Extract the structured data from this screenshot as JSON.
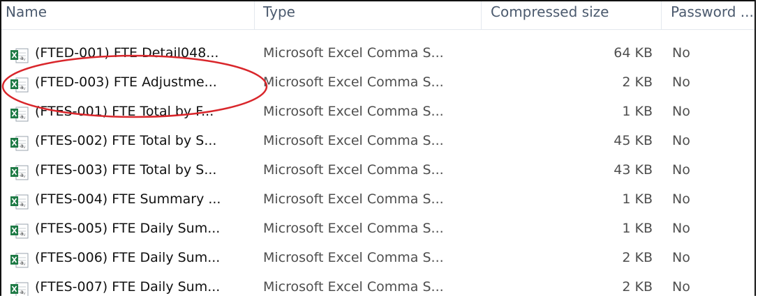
{
  "columns": {
    "name": "Name",
    "type": "Type",
    "compressed_size": "Compressed size",
    "password": "Password ..."
  },
  "files": [
    {
      "name": "(FTED-001) FTE Detail048...",
      "type": "Microsoft Excel Comma S...",
      "size": "64 KB",
      "password": "No",
      "icon": "excel-csv-icon"
    },
    {
      "name": "(FTED-003) FTE Adjustme...",
      "type": "Microsoft Excel Comma S...",
      "size": "2 KB",
      "password": "No",
      "icon": "excel-csv-icon"
    },
    {
      "name": "(FTES-001) FTE Total by F...",
      "type": "Microsoft Excel Comma S...",
      "size": "1 KB",
      "password": "No",
      "icon": "excel-csv-icon"
    },
    {
      "name": "(FTES-002) FTE Total by S...",
      "type": "Microsoft Excel Comma S...",
      "size": "45 KB",
      "password": "No",
      "icon": "excel-csv-icon"
    },
    {
      "name": "(FTES-003) FTE Total by S...",
      "type": "Microsoft Excel Comma S...",
      "size": "43 KB",
      "password": "No",
      "icon": "excel-csv-icon"
    },
    {
      "name": "(FTES-004) FTE Summary ...",
      "type": "Microsoft Excel Comma S...",
      "size": "1 KB",
      "password": "No",
      "icon": "excel-csv-icon"
    },
    {
      "name": "(FTES-005) FTE Daily Sum...",
      "type": "Microsoft Excel Comma S...",
      "size": "1 KB",
      "password": "No",
      "icon": "excel-csv-icon"
    },
    {
      "name": "(FTES-006) FTE Daily Sum...",
      "type": "Microsoft Excel Comma S...",
      "size": "2 KB",
      "password": "No",
      "icon": "excel-csv-icon"
    },
    {
      "name": "(FTES-007) FTE Daily Sum...",
      "type": "Microsoft Excel Comma S...",
      "size": "2 KB",
      "password": "No",
      "icon": "excel-csv-icon"
    }
  ],
  "annotation": {
    "highlighted_item": "(FTED-003) FTE Adjustme...",
    "color": "#d9262b"
  },
  "colors": {
    "excel_green": "#1e7a45",
    "header_text": "#4b5a6e"
  }
}
